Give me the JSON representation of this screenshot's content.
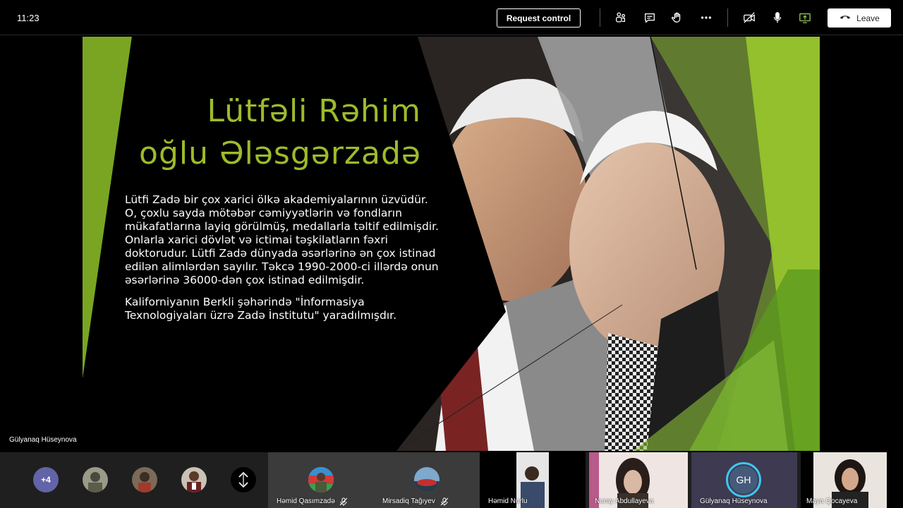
{
  "topbar": {
    "time": "11:23",
    "request_control_label": "Request control",
    "leave_label": "Leave",
    "icons": [
      "participants-icon",
      "chat-icon",
      "raise-hand-icon",
      "more-options-icon",
      "camera-off-icon",
      "microphone-icon",
      "share-screen-icon",
      "phone-hangup-icon"
    ],
    "share_color": "#92c353"
  },
  "slide": {
    "title_line1": "Lütfəli Rəhim",
    "title_line2": "oğlu Ələsgərzadə",
    "paragraph1": "Lütfi Zadə bir çox xarici ölkə akademiyalarının üzvüdür. O, çoxlu sayda mötəbər cəmiyyətlərin və fondların mükafatlarına layiq görülmüş, medallarla təltif edilmişdir. Onlarla xarici dövlət və ictimai təşkilatların fəxri doktorudur. Lütfi Zadə dünyada əsərlərinə ən çox istinad edilən alimlərdən sayılır. Təkcə 1990-2000-ci illərdə onun əsərlərinə 36000-dən çox istinad edilmişdir.",
    "paragraph2": "Kaliforniyanın Berkli şəhərində \"İnformasiya Texnologiyaları üzrə Zadə İnstitutu\" yaradılmışdır.",
    "accent_color": "#9dbb2c"
  },
  "presenter": {
    "name": "Gülyanaq Hüseynova"
  },
  "participants": {
    "overflow_count": "+4",
    "tiles": [
      {
        "name": "Həmid Qasımzadə",
        "muted": true
      },
      {
        "name": "Mirsadiq Tağıyev",
        "muted": true
      },
      {
        "name": "Həmid Nurlu",
        "muted": false
      },
      {
        "name": "Nuray Abdullayeva",
        "muted": false
      },
      {
        "name": "Gülyanaq Hüseynova",
        "initials": "GH",
        "muted": false
      },
      {
        "name": "Maya Qocayeva",
        "muted": false
      }
    ]
  }
}
